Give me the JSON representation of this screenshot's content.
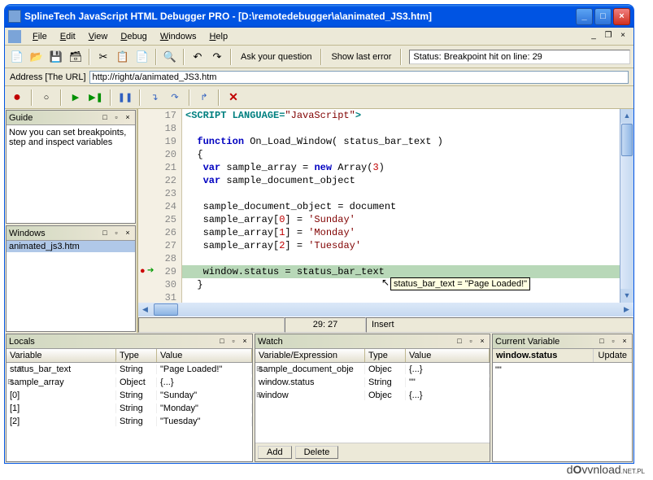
{
  "title": "SplineTech JavaScript HTML Debugger PRO - [D:\\remotedebugger\\a\\animated_JS3.htm]",
  "menus": {
    "file": "File",
    "edit": "Edit",
    "view": "View",
    "debug": "Debug",
    "windows": "Windows",
    "help": "Help"
  },
  "toolbar": {
    "ask": "Ask your question",
    "showlast": "Show last error",
    "status": "Status: Breakpoint hit on line: 29"
  },
  "address": {
    "label": "Address [The URL]",
    "value": "http://right/a/animated_JS3.htm"
  },
  "guide": {
    "title": "Guide",
    "text": "Now you can set breakpoints, step and inspect variables"
  },
  "windows": {
    "title": "Windows",
    "item": "animated_js3.htm"
  },
  "code": {
    "lines": [
      {
        "n": 17,
        "html": "<span class='tag'>&lt;SCRIPT LANGUAGE=</span><span class='str'>\"JavaScript\"</span><span class='tag'>&gt;</span>"
      },
      {
        "n": 18,
        "html": ""
      },
      {
        "n": 19,
        "html": "  <span class='kw'>function</span> On_Load_Window( status_bar_text )"
      },
      {
        "n": 20,
        "html": "  {"
      },
      {
        "n": 21,
        "html": "   <span class='kw'>var</span> sample_array = <span class='kw'>new</span> Array(<span class='num'>3</span>)"
      },
      {
        "n": 22,
        "html": "   <span class='kw'>var</span> sample_document_object"
      },
      {
        "n": 23,
        "html": ""
      },
      {
        "n": 24,
        "html": "   sample_document_object = document"
      },
      {
        "n": 25,
        "html": "   sample_array[<span class='num'>0</span>] = <span class='str'>'Sunday'</span>"
      },
      {
        "n": 26,
        "html": "   sample_array[<span class='num'>1</span>] = <span class='str'>'Monday'</span>"
      },
      {
        "n": 27,
        "html": "   sample_array[<span class='num'>2</span>] = <span class='str'>'Tuesday'</span>"
      },
      {
        "n": 28,
        "html": ""
      },
      {
        "n": 29,
        "html": "   window.status = status_bar_text",
        "hl": true,
        "bp": true
      },
      {
        "n": 30,
        "html": "  }"
      },
      {
        "n": 31,
        "html": ""
      }
    ],
    "tooltip": "status_bar_text = \"Page Loaded!\""
  },
  "status": {
    "pos": "29: 27",
    "mode": "Insert"
  },
  "locals": {
    "title": "Locals",
    "cols": {
      "var": "Variable",
      "type": "Type",
      "value": "Value"
    },
    "rows": [
      {
        "var": "status_bar_text",
        "type": "String",
        "value": "\"Page Loaded!\"",
        "indent": "tree leaf"
      },
      {
        "var": "sample_array",
        "type": "Object",
        "value": "{...}",
        "indent": "tree"
      },
      {
        "var": "[0]",
        "type": "String",
        "value": "\"Sunday\"",
        "indent": "subtree"
      },
      {
        "var": "[1]",
        "type": "String",
        "value": "\"Monday\"",
        "indent": "subtree"
      },
      {
        "var": "[2]",
        "type": "String",
        "value": "\"Tuesday\"",
        "indent": "subtree"
      }
    ]
  },
  "watch": {
    "title": "Watch",
    "cols": {
      "var": "Variable/Expression",
      "type": "Type",
      "value": "Value"
    },
    "rows": [
      {
        "var": "sample_document_obje",
        "type": "Objec",
        "value": "{...}",
        "indent": "tree plus"
      },
      {
        "var": "window.status",
        "type": "String",
        "value": "\"\"",
        "indent": "tree dash"
      },
      {
        "var": "window",
        "type": "Objec",
        "value": "{...}",
        "indent": "tree"
      }
    ],
    "add": "Add",
    "delete": "Delete"
  },
  "curvar": {
    "title": "Current Variable",
    "name": "window.status",
    "update": "Update",
    "value": "\"\""
  },
  "watermark": "dOvvnload"
}
